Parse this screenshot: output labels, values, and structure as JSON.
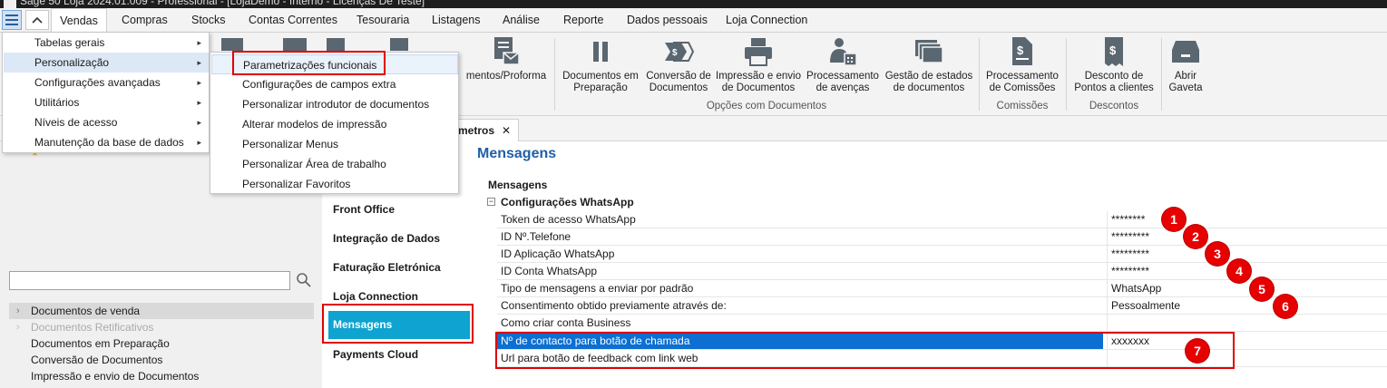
{
  "window": {
    "title": "Sage 50 Loja 2024.01.009 - Professional - [LojaDemo - Interno - Licenças De Teste]"
  },
  "menubar": {
    "tabs": [
      "Vendas",
      "Compras",
      "Stocks",
      "Contas Correntes",
      "Tesouraria",
      "Listagens",
      "Análise",
      "Reporte",
      "Dados pessoais",
      "Loja Connection"
    ]
  },
  "ribbon": {
    "buttons": [
      {
        "label1": "mentos/Proforma",
        "label2": "",
        "icon": "document-mail-icon"
      },
      {
        "label1": "Documentos em",
        "label2": "Preparação",
        "icon": "pause-icon"
      },
      {
        "label1": "Conversão de",
        "label2": "Documentos",
        "icon": "convert-icon"
      },
      {
        "label1": "Impressão e envio",
        "label2": "de Documentos",
        "icon": "printer-icon"
      },
      {
        "label1": "Processamento",
        "label2": "de avenças",
        "icon": "person-calendar-icon"
      },
      {
        "label1": "Gestão de estados",
        "label2": "de documentos",
        "icon": "documents-stack-icon"
      },
      {
        "label1": "Processamento",
        "label2": "de Comissões",
        "icon": "commission-doc-icon"
      },
      {
        "label1": "Desconto de",
        "label2": "Pontos a clientes",
        "icon": "discount-receipt-icon"
      },
      {
        "label1": "Abrir",
        "label2": "Gaveta",
        "icon": "cash-drawer-icon"
      }
    ],
    "groups": [
      "Opções com Documentos",
      "Comissões",
      "Descontos"
    ]
  },
  "doctab": {
    "label": "metros",
    "close": "✕"
  },
  "mainmenu": {
    "items": [
      {
        "label": "Tabelas gerais"
      },
      {
        "label": "Personalização"
      },
      {
        "label": "Configurações avançadas"
      },
      {
        "label": "Utilitários"
      },
      {
        "label": "Níveis de acesso"
      },
      {
        "label": "Manutenção da base de dados"
      }
    ],
    "submenu": [
      "Parametrizações funcionais",
      "Configurações de campos extra",
      "Personalizar introdutor de documentos",
      "Alterar modelos de impressão",
      "Personalizar Menus",
      "Personalizar Área de trabalho",
      "Personalizar Favoritos"
    ]
  },
  "leftpane": {
    "search": {
      "value": "",
      "placeholder": ""
    },
    "items": [
      {
        "label": "Documentos de venda",
        "expand": "›"
      },
      {
        "label": "Documentos Retificativos",
        "expand": "›"
      },
      {
        "label": "Documentos em Preparação"
      },
      {
        "label": "Conversão de Documentos"
      },
      {
        "label": "Impressão e envio de Documentos"
      }
    ]
  },
  "midnav": {
    "items": [
      "Front Office",
      "Integração de Dados",
      "Faturação Eletrónica",
      "Loja Connection",
      "Mensagens",
      "Payments Cloud"
    ]
  },
  "main": {
    "title": "Mensagens",
    "section": "Mensagens",
    "group": "Configurações WhatsApp",
    "rows": [
      {
        "name": "Token de acesso WhatsApp",
        "value": "********"
      },
      {
        "name": "ID Nº.Telefone",
        "value": "*********"
      },
      {
        "name": "ID Aplicação WhatsApp",
        "value": "*********"
      },
      {
        "name": "ID Conta WhatsApp",
        "value": "*********"
      },
      {
        "name": "Tipo de mensagens a enviar por padrão",
        "value": "WhatsApp"
      },
      {
        "name": "Consentimento obtido previamente através de:",
        "value": "Pessoalmente"
      },
      {
        "name": "Como criar conta Business",
        "value": ""
      },
      {
        "name": "Nº de contacto para botão de chamada",
        "value": "xxxxxxx"
      },
      {
        "name": "Url para botão de feedback com link web",
        "value": ""
      }
    ]
  },
  "badges": [
    "1",
    "2",
    "3",
    "4",
    "5",
    "6",
    "7"
  ],
  "colors": {
    "accent": "#0ea3d0",
    "selection": "#0c6fd1",
    "annotation": "#e60000",
    "title": "#1f5fa8"
  }
}
